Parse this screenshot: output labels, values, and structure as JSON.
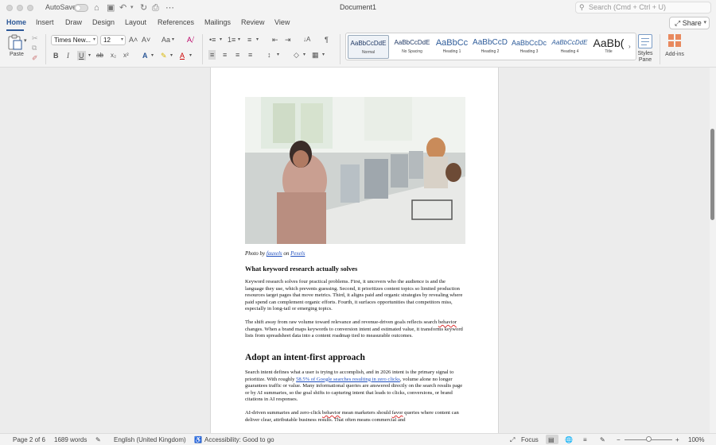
{
  "titlebar": {
    "autosave_label": "AutoSave",
    "document_title": "Document1",
    "search_placeholder": "Search (Cmd + Ctrl + U)"
  },
  "tabs": [
    {
      "label": "Home",
      "active": true
    },
    {
      "label": "Insert"
    },
    {
      "label": "Draw"
    },
    {
      "label": "Design"
    },
    {
      "label": "Layout"
    },
    {
      "label": "References"
    },
    {
      "label": "Mailings"
    },
    {
      "label": "Review"
    },
    {
      "label": "View"
    }
  ],
  "share_label": "Share",
  "ribbon": {
    "paste_label": "Paste",
    "font_name": "Times New...",
    "font_size": "12",
    "styles": [
      {
        "preview": "AaBbCcDdE",
        "name": "Normal"
      },
      {
        "preview": "AaBbCcDdE",
        "name": "No Spacing"
      },
      {
        "preview": "AaBbCc",
        "name": "Heading 1"
      },
      {
        "preview": "AaBbCcD",
        "name": "Heading 2"
      },
      {
        "preview": "AaBbCcDc",
        "name": "Heading 3"
      },
      {
        "preview": "AaBbCcDdE",
        "name": "Heading 4"
      },
      {
        "preview": "AaBb(",
        "name": "Title"
      }
    ],
    "styles_pane_label": "Styles Pane",
    "addins_label": "Add-ins",
    "icons": {
      "grow_font": "A˄",
      "shrink_font": "A˅",
      "change_case": "Aa",
      "clear_format": "A⧸",
      "bold": "B",
      "italic": "I",
      "underline": "U",
      "strike": "ab",
      "subscript": "x₂",
      "superscript": "x²",
      "text_effects": "A",
      "highlight": "✎",
      "font_color": "A",
      "bullets": "•≡",
      "numbering": "1≡",
      "multilevel": "≡",
      "decrease_indent": "⇤",
      "increase_indent": "⇥",
      "sort": "↓A",
      "show_marks": "¶",
      "line_spacing": "↕",
      "shading": "◇",
      "borders": "▦"
    }
  },
  "document": {
    "caption_prefix": "Photo by ",
    "caption_author": "fauxels",
    "caption_mid": " on ",
    "caption_site": "Pexels",
    "heading1": "What keyword research actually solves",
    "para1": "Keyword research solves four practical problems. First, it uncovers who the audience is and the language they use, which prevents guessing. Second, it prioritizes content topics so limited production resources target pages that move metrics. Third, it aligns paid and organic strategies by revealing where paid spend can complement organic efforts. Fourth, it surfaces opportunities that competitors miss, especially in long-tail or emerging topics.",
    "para2_a": "The shift away from raw volume toward relevance and revenue-driven goals reflects search ",
    "para2_err": "behavior",
    "para2_b": " changes. When a brand maps keywords to conversion intent and estimated value, it transforms keyword lists from spreadsheet data into a content roadmap tied to measurable outcomes.",
    "heading2": "Adopt an intent-first approach",
    "para3_a": "Search intent defines what a user is trying to accomplish, and in 2026 intent is the primary signal to prioritize. With roughly ",
    "para3_link": "58.5% of Google searches resulting in zero clicks",
    "para3_b": ", volume alone no longer guarantees traffic or value. Many informational queries are answered directly on the search results page or by AI summaries, so the goal shifts to capturing intent that leads to clicks, conversions, or brand citations in AI responses.",
    "para4_a": "AI-driven summaries and zero-click ",
    "para4_err1": "behavior",
    "para4_b": " mean marketers should ",
    "para4_err2": "favor",
    "para4_c": " queries where content can deliver clear, attributable business results. That often means commercial and"
  },
  "statusbar": {
    "page": "Page 2 of 6",
    "words": "1689 words",
    "language": "English (United Kingdom)",
    "accessibility": "Accessibility: Good to go",
    "focus": "Focus",
    "zoom": "100%"
  }
}
